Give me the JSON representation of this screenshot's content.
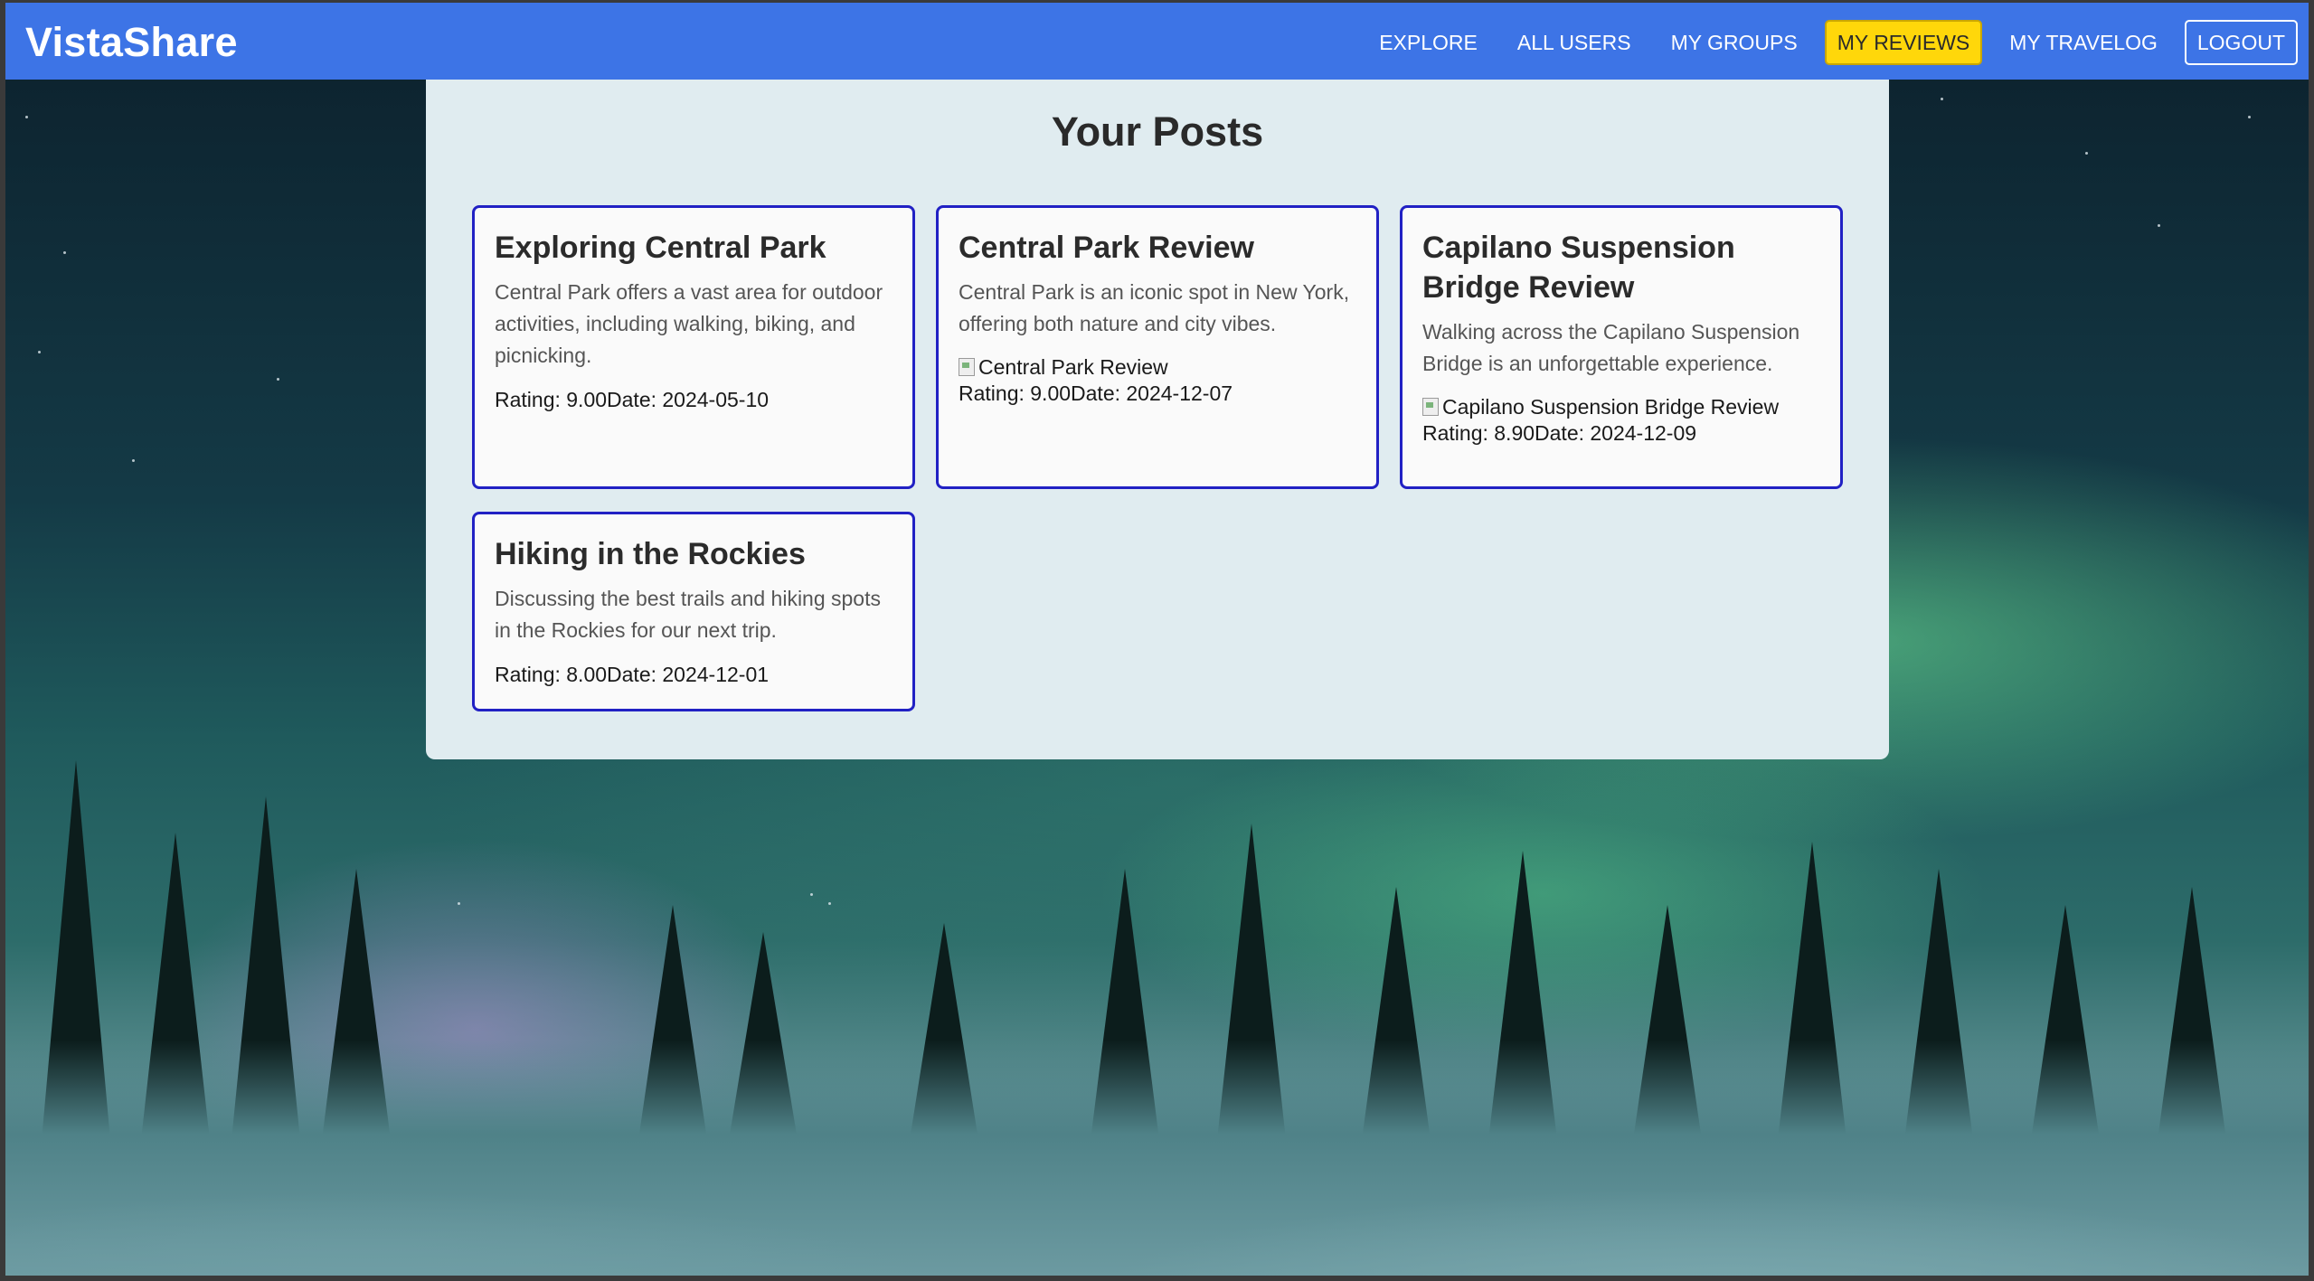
{
  "app": {
    "brand": "VistaShare"
  },
  "nav": {
    "items": [
      {
        "label": "EXPLORE"
      },
      {
        "label": "ALL USERS"
      },
      {
        "label": "MY GROUPS"
      },
      {
        "label": "MY REVIEWS"
      },
      {
        "label": "MY TRAVELOG"
      },
      {
        "label": "LOGOUT"
      }
    ],
    "active": "MY REVIEWS"
  },
  "page": {
    "title": "Your Posts"
  },
  "posts": [
    {
      "title": "Exploring Central Park",
      "description": "Central Park offers a vast area for outdoor activities, including walking, biking, and picnicking.",
      "image_alt": "",
      "rating_label": "Rating: 9.00",
      "date_label": "Date: 2024-05-10"
    },
    {
      "title": "Central Park Review",
      "description": "Central Park is an iconic spot in New York, offering both nature and city vibes.",
      "image_alt": "Central Park Review",
      "rating_label": "Rating: 9.00",
      "date_label": "Date: 2024-12-07"
    },
    {
      "title": "Capilano Suspension Bridge Review",
      "description": "Walking across the Capilano Suspension Bridge is an unforgettable experience.",
      "image_alt": "Capilano Suspension Bridge Review",
      "rating_label": "Rating: 8.90",
      "date_label": "Date: 2024-12-09"
    },
    {
      "title": "Hiking in the Rockies",
      "description": "Discussing the best trails and hiking spots in the Rockies for our next trip.",
      "image_alt": "",
      "rating_label": "Rating: 8.00",
      "date_label": "Date: 2024-12-01"
    }
  ],
  "colors": {
    "navbar": "#3d74e6",
    "active_nav": "#ffd70a",
    "card_border": "#2121c4",
    "panel": "#e0ecf0"
  }
}
